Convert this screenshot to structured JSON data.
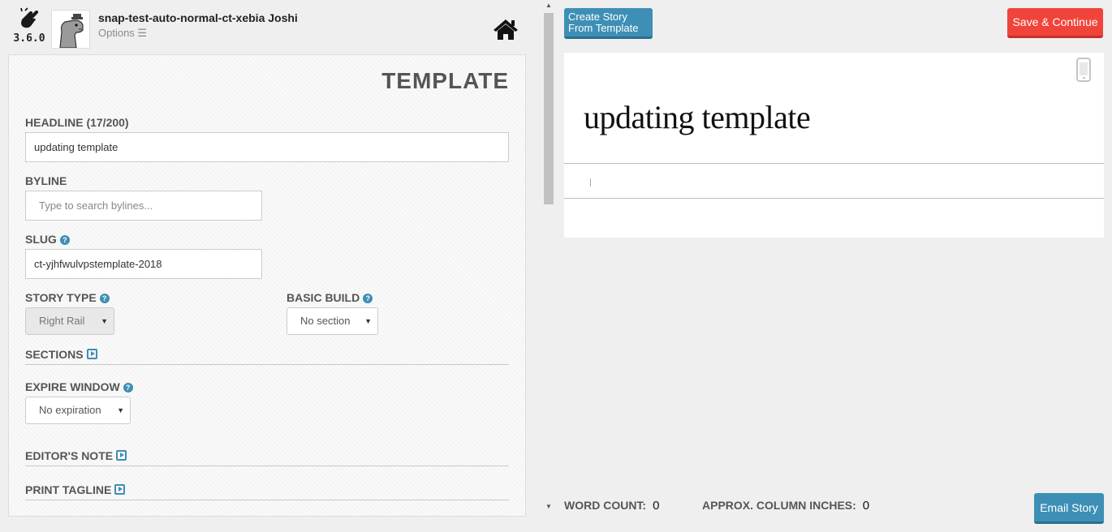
{
  "app": {
    "version": "3.6.0",
    "username": "snap-test-auto-normal-ct-xebia Joshi",
    "options_label": "Options ☰"
  },
  "form": {
    "title": "TEMPLATE",
    "headline": {
      "label": "HEADLINE (17/200)",
      "value": "updating template"
    },
    "byline": {
      "label": "BYLINE",
      "placeholder": "Type to search bylines..."
    },
    "slug": {
      "label": "SLUG",
      "value": "ct-yjhfwulvpstemplate-2018"
    },
    "story_type": {
      "label": "STORY TYPE",
      "selected": "Right Rail"
    },
    "basic_build": {
      "label": "BASIC BUILD",
      "selected": "No section"
    },
    "sections": {
      "label": "SECTIONS"
    },
    "expire_window": {
      "label": "EXPIRE WINDOW",
      "selected": "No expiration"
    },
    "editors_note": {
      "label": "EDITOR'S NOTE"
    },
    "print_tagline": {
      "label": "PRINT TAGLINE"
    }
  },
  "toolbar": {
    "create_from_template_line1": "Create Story",
    "create_from_template_line2": "From Template",
    "save_label": "Save & Continue",
    "email_label": "Email Story"
  },
  "preview": {
    "headline": "updating template",
    "body": "|"
  },
  "stats": {
    "word_count_label": "WORD COUNT:",
    "word_count": "0",
    "column_inches_label": "APPROX. COLUMN INCHES:",
    "column_inches": "0"
  },
  "colors": {
    "accent": "#3d8fb5",
    "save": "#f0443a",
    "background": "#efefef"
  },
  "icons": {
    "logo": "snapping-hand-icon",
    "home": "home-icon",
    "help": "question-icon",
    "expand": "expand-play-icon",
    "mobile_preview": "mobile-phone-icon"
  }
}
